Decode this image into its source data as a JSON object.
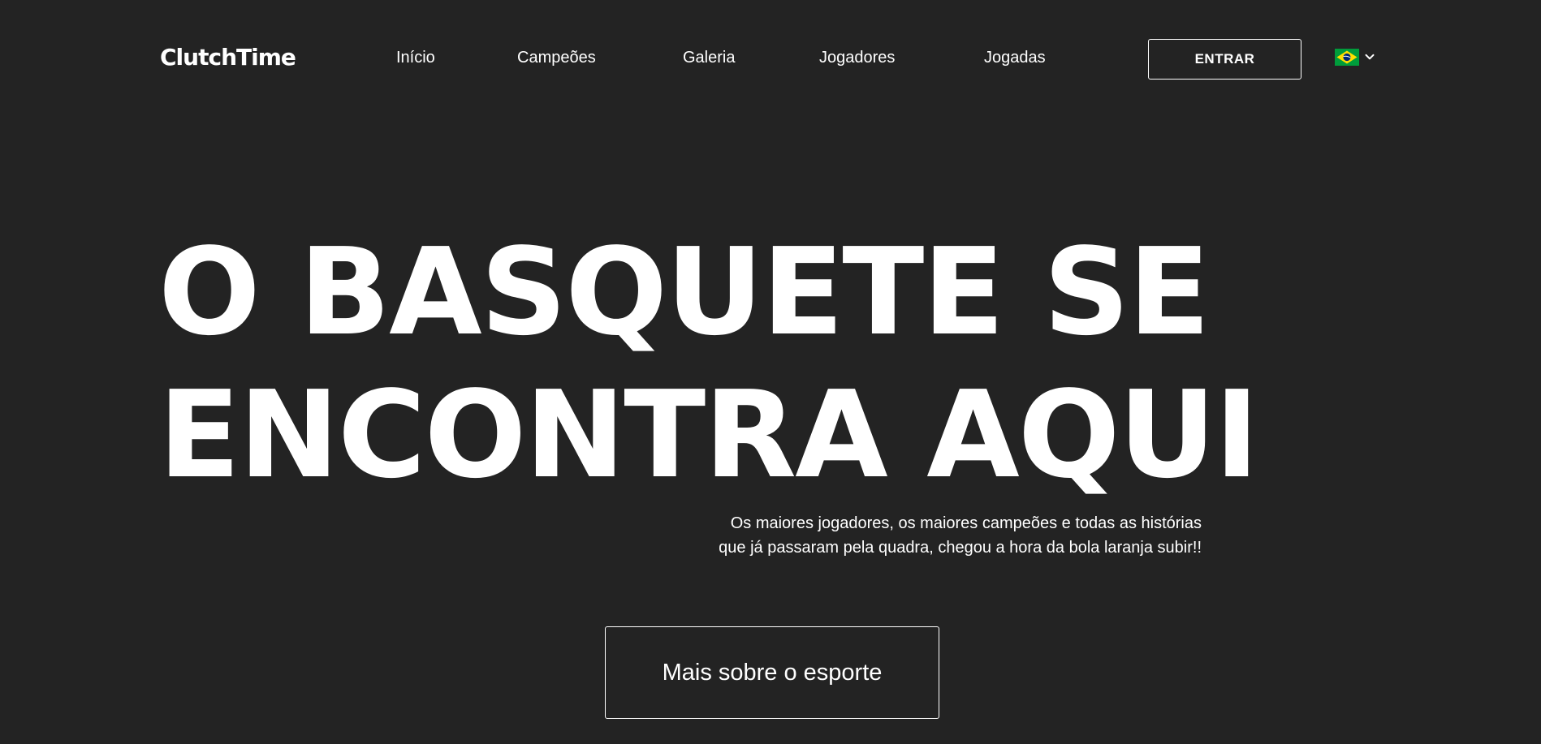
{
  "header": {
    "logo_text": "ClutchTime",
    "nav": [
      {
        "label": "Início"
      },
      {
        "label": "Campeões"
      },
      {
        "label": "Galeria"
      },
      {
        "label": "Jogadores"
      },
      {
        "label": "Jogadas"
      }
    ],
    "login_label": "ENTRAR",
    "language": {
      "icon": "brazil-flag-icon",
      "dropdown_icon": "chevron-down-icon"
    }
  },
  "hero": {
    "title_line1": "O BASQUETE SE",
    "title_line2": "ENCONTRA AQUI",
    "subtitle_line1": "Os maiores jogadores, os maiores campeões e todas as histórias",
    "subtitle_line2": "que já passaram pela quadra, chegou a hora da bola laranja subir!!",
    "cta_label": "Mais sobre o esporte"
  },
  "colors": {
    "background": "#232323",
    "text": "#ffffff",
    "flag_green": "#009c3b",
    "flag_yellow": "#ffdf00",
    "flag_blue": "#002776"
  }
}
